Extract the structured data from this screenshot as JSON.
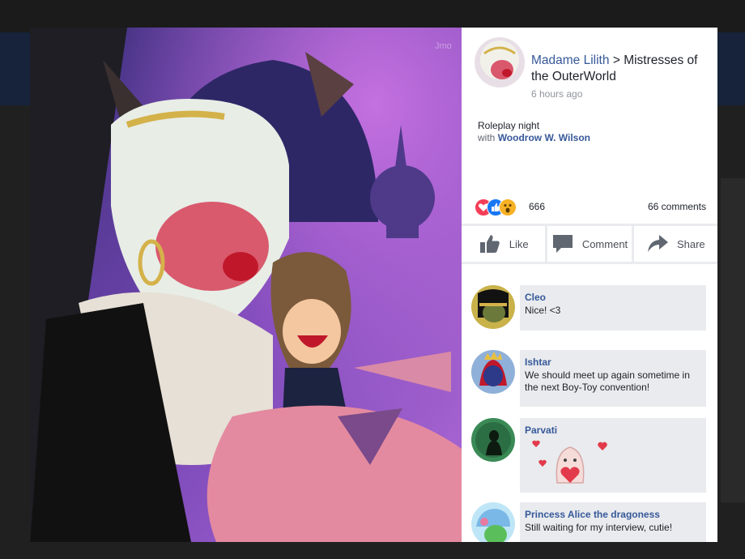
{
  "post": {
    "author": "Madame Lilith",
    "separator": ">",
    "group": "Mistresses of the OuterWorld",
    "time": "6 hours ago",
    "text": "Roleplay night",
    "with_label": "with",
    "tagged": "Woodrow W. Wilson"
  },
  "reactions": {
    "icons": [
      "love-reaction-icon",
      "like-reaction-icon",
      "wow-reaction-icon"
    ],
    "count": "666",
    "comments_count": "66 comments"
  },
  "actions": [
    {
      "label": "Like",
      "icon": "thumbs-up-icon"
    },
    {
      "label": "Comment",
      "icon": "comment-icon"
    },
    {
      "label": "Share",
      "icon": "share-icon"
    }
  ],
  "comments": [
    {
      "name": "Cleo",
      "text": "Nice! <3"
    },
    {
      "name": "Ishtar",
      "text": "We should meet up again sometime in the next Boy-Toy convention!"
    },
    {
      "name": "Parvati",
      "text": ""
    },
    {
      "name": "Princess Alice the dragoness",
      "text": "Still waiting for my interview, cutie!"
    }
  ],
  "colors": {
    "link": "#365899",
    "bubble": "#e9ebee",
    "like_blue": "#1877f2",
    "love_red": "#f33e58",
    "wow_yellow": "#f7b125"
  }
}
